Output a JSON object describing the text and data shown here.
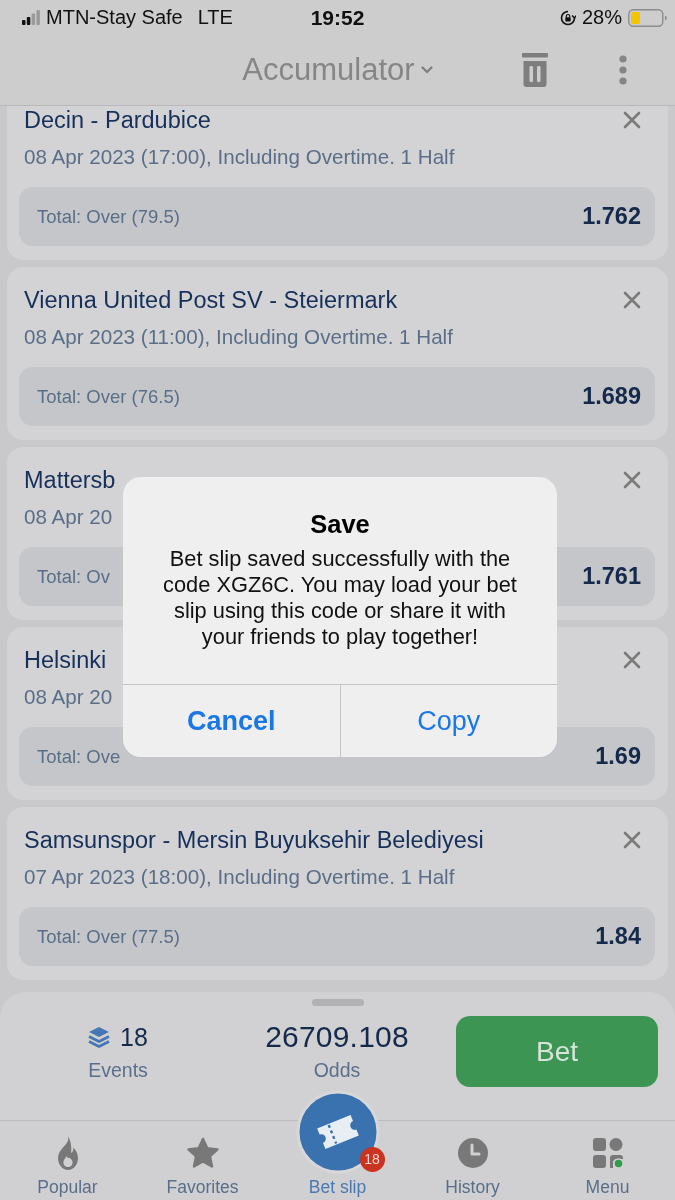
{
  "status_bar": {
    "carrier": "MTN-Stay Safe",
    "network": "LTE",
    "time": "19:52",
    "battery_percent": "28%"
  },
  "header": {
    "title": "Accumulator"
  },
  "bets": [
    {
      "title": "Decin - Pardubice",
      "details": "08 Apr 2023 (17:00), Including Overtime. 1 Half",
      "outcome": "Total: Over (79.5)",
      "odds": "1.762"
    },
    {
      "title": "Vienna United Post SV - Steiermark",
      "details": "08 Apr 2023 (11:00), Including Overtime. 1 Half",
      "outcome": "Total: Over (76.5)",
      "odds": "1.689"
    },
    {
      "title": "Mattersb",
      "details": "08 Apr 20",
      "outcome": "Total: Ov",
      "odds": "1.761"
    },
    {
      "title": "Helsinki",
      "details": "08 Apr 20",
      "outcome": "Total: Ove",
      "odds": "1.69"
    },
    {
      "title": "Samsunspor - Mersin Buyuksehir Belediyesi",
      "details": "07 Apr 2023 (18:00), Including Overtime. 1 Half",
      "outcome": "Total: Over (77.5)",
      "odds": "1.84"
    }
  ],
  "summary": {
    "events_count": "18",
    "events_label": "Events",
    "total_odds": "26709.108",
    "odds_label": "Odds",
    "bet_button": "Bet"
  },
  "tabs": [
    {
      "label": "Popular",
      "selected": false
    },
    {
      "label": "Favorites",
      "selected": false
    },
    {
      "label": "Bet slip",
      "selected": true,
      "badge": "18"
    },
    {
      "label": "History",
      "selected": false
    },
    {
      "label": "Menu",
      "selected": false
    }
  ],
  "dialog": {
    "title": "Save",
    "message": "Bet slip saved successfully with the code XGZ6C. You may load your bet slip using this code or share it with your friends to play together!",
    "buttons": [
      {
        "label": "Cancel",
        "kind": "preferred"
      },
      {
        "label": "Copy",
        "kind": "normal"
      }
    ]
  }
}
